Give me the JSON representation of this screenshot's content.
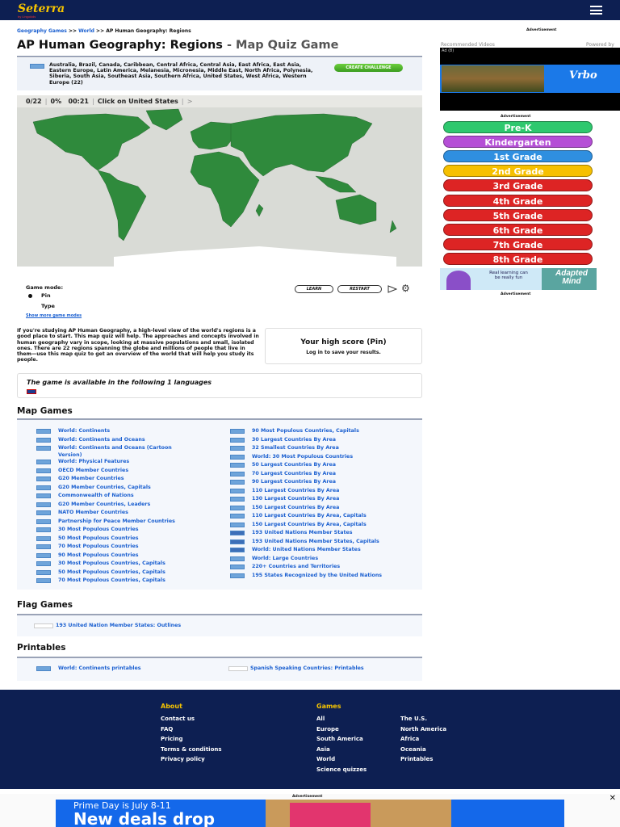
{
  "header": {
    "logo": "Seterra",
    "logo_sub": "by Lingokids"
  },
  "breadcrumb": {
    "items": [
      "Geography Games",
      "World"
    ],
    "separator": ">>",
    "current": "AP Human Geography: Regions"
  },
  "title": {
    "main": "AP Human Geography: Regions",
    "sub": "- Map Quiz Game"
  },
  "info": {
    "regions_text": "Australia, Brazil, Canada, Caribbean, Central Africa, Central Asia, East Africa, East Asia, Eastern Europe, Latin America, Melanesia, Micronesia, Middle East, North Africa, Polynesia, Siberia, South Asia, Southeast Asia, Southern Africa, United States, West Africa, Western Europe (22)",
    "create_challenge": "CREATE CHALLENGE"
  },
  "quiz": {
    "progress": "0/22",
    "percent": "0%",
    "timer": "00:21",
    "prompt": "Click on",
    "target": "United States",
    "skip": ">"
  },
  "game_mode": {
    "label": "Game mode:",
    "options": [
      "Pin",
      "Type"
    ],
    "selected": "Pin",
    "show_more": "Show more game modes",
    "learn": "LEARN",
    "restart": "RESTART"
  },
  "description": "If you're studying AP Human Geography, a high-level view of the world's regions is a good place to start. This map quiz will help. The approaches and concepts involved in human geography vary in scope, looking at massive populations and small, isolated ones. There are 22 regions spanning the globe and millions of people that live in them—use this map quiz to get an overview of the world that will help you study its people.",
  "high_score": {
    "title": "Your high score (Pin)",
    "subtitle": "Log in to save your results."
  },
  "languages": {
    "title": "The game is available in the following 1 languages"
  },
  "map_games": {
    "heading": "Map Games",
    "left": [
      "World: Continents",
      "World: Continents and Oceans",
      "World: Continents and Oceans (Cartoon Version)",
      "World: Physical Features",
      "OECD Member Countries",
      "G20 Member Countries",
      "G20 Member Countries, Capitals",
      "Commonwealth of Nations",
      "G20 Member Countries, Leaders",
      "NATO Member Countries",
      "Partnership for Peace Member Countries",
      "30 Most Populous Countries",
      "50 Most Populous Countries",
      "70 Most Populous Countries",
      "90 Most Populous Countries",
      "30 Most Populous Countries, Capitals",
      "50 Most Populous Countries, Capitals",
      "70 Most Populous Countries, Capitals"
    ],
    "right": [
      "90 Most Populous Countries, Capitals",
      "30 Largest Countries By Area",
      "32 Smallest Countries By Area",
      "World: 30 Most Populous Countries",
      "50 Largest Countries By Area",
      "70 Largest Countries By Area",
      "90 Largest Countries By Area",
      "110 Largest Countries By Area",
      "130 Largest Countries By Area",
      "150 Largest Countries By Area",
      "110 Largest Countries By Area, Capitals",
      "150 Largest Countries By Area, Capitals",
      "193 United Nations Member States",
      "193 United Nations Member States, Capitals",
      "World: United Nations Member States",
      "World: Large Countries",
      "220+ Countries and Territories",
      "195 States Recognized by the United Nations"
    ]
  },
  "flag_games": {
    "heading": "Flag Games",
    "items": [
      "193 United Nation Member States: Outlines"
    ]
  },
  "printables": {
    "heading": "Printables",
    "items": [
      "World: Continents printables",
      "Spanish Speaking Countries: Printables"
    ]
  },
  "footer": {
    "about": {
      "heading": "About",
      "links": [
        "Contact us",
        "FAQ",
        "Pricing",
        "Terms & conditions",
        "Privacy policy"
      ]
    },
    "games": {
      "heading": "Games",
      "col1": [
        "All",
        "Europe",
        "South America",
        "Asia",
        "World",
        "Science quizzes"
      ],
      "col2": [
        "The U.S.",
        "North America",
        "Africa",
        "Oceania",
        "Printables"
      ]
    }
  },
  "sidebar": {
    "ad_label": "Advertisement",
    "recommended": "Recommended Videos",
    "powered": "Powered by",
    "ad_count": "Ad (8)",
    "vrbo": "Vrbo",
    "grades": [
      {
        "label": "Pre-K",
        "color": "#2ec86e"
      },
      {
        "label": "Kindergarten",
        "color": "#b54fd6"
      },
      {
        "label": "1st Grade",
        "color": "#2f8fe0"
      },
      {
        "label": "2nd Grade",
        "color": "#f6c000"
      },
      {
        "label": "3rd Grade",
        "color": "#dd2424"
      },
      {
        "label": "4th Grade",
        "color": "#dd2424"
      },
      {
        "label": "5th Grade",
        "color": "#dd2424"
      },
      {
        "label": "6th Grade",
        "color": "#dd2424"
      },
      {
        "label": "7th Grade",
        "color": "#dd2424"
      },
      {
        "label": "8th Grade",
        "color": "#dd2424"
      }
    ],
    "adapted_text": "Real learning can be really fun",
    "adapted_name": "Adapted Mind"
  },
  "bottom_ad": {
    "label": "Advertisement",
    "line1": "Prime Day is July 8-11",
    "line2": "New deals drop",
    "close": "✕"
  }
}
